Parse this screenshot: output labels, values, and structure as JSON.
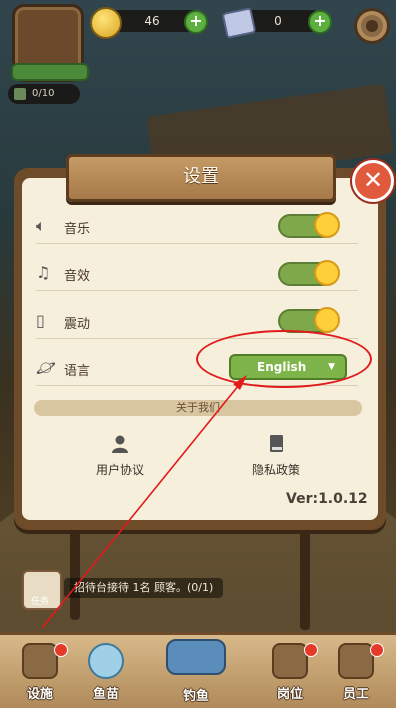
{
  "hud": {
    "coins": "46",
    "gems": "0",
    "capacity": "0/10"
  },
  "settings": {
    "title": "设置",
    "close_symbol": "✕",
    "rows": [
      {
        "icon": "speaker-icon",
        "label": "音乐",
        "on": true
      },
      {
        "icon": "music-note-icon",
        "label": "音效",
        "on": true
      },
      {
        "icon": "vibrate-icon",
        "label": "震动",
        "on": true
      }
    ],
    "language": {
      "label": "语言",
      "value": "English"
    },
    "about_header": "关于我们",
    "user_agreement": "用户协议",
    "privacy_policy": "隐私政策",
    "version": "Ver:1.0.12"
  },
  "task": {
    "label": "任务",
    "text": "招待台接待 1名 顾客。(0/1)"
  },
  "nav": [
    {
      "label": "设施",
      "icon": "facility-icon",
      "badge": true
    },
    {
      "label": "鱼苗",
      "icon": "fishbowl-icon",
      "badge": false
    },
    {
      "label": "钓鱼",
      "icon": "boat-icon",
      "badge": false
    },
    {
      "label": "岗位",
      "icon": "post-icon",
      "badge": true
    },
    {
      "label": "员工",
      "icon": "staff-icon",
      "badge": true
    }
  ],
  "colors": {
    "accent_green": "#7eb44a",
    "toggle_knob": "#ffcf3a",
    "close_red": "#e25a3e",
    "annotation_red": "#e21a1a"
  }
}
